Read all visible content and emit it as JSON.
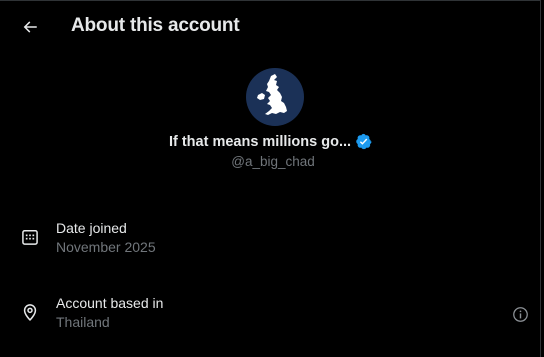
{
  "header": {
    "title": "About this account",
    "back_icon": "arrow-left-icon"
  },
  "profile": {
    "display_name": "If that means millions go...",
    "handle": "@a_big_chad",
    "verified": true,
    "verified_color": "#1d9bf0",
    "avatar_bg": "#1b3157"
  },
  "details": [
    {
      "label": "Date joined",
      "value": "November 2025",
      "icon": "calendar-icon"
    },
    {
      "label": "Account based in",
      "value": "Thailand",
      "icon": "location-pin-icon",
      "action_icon": "info-icon"
    }
  ],
  "colors": {
    "background": "#000000",
    "primary_text": "#e7e9ea",
    "secondary_text": "#71767b",
    "border": "#2f3336"
  }
}
